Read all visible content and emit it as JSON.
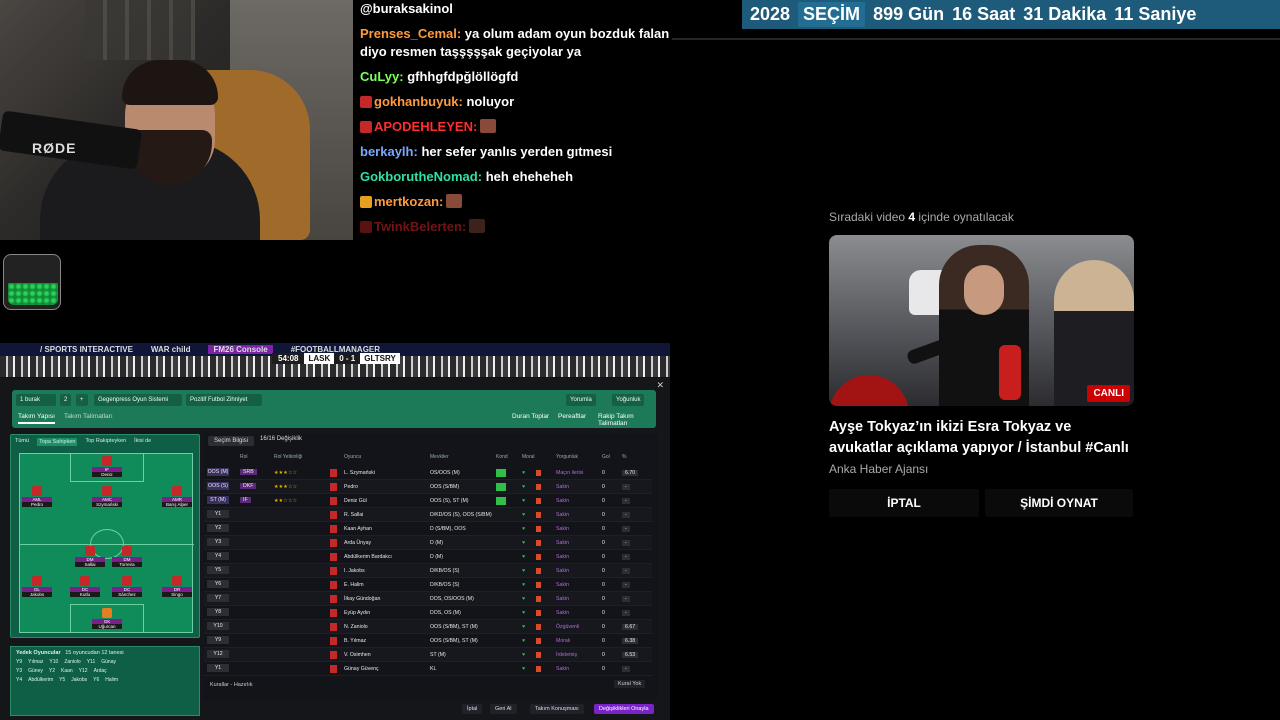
{
  "chat": {
    "messages": [
      {
        "user": "@buraksakinol",
        "text": "",
        "color": "#ffffff",
        "badge": ""
      },
      {
        "user": "Prenses_Cemal:",
        "text": "ya olum adam oyun bozduk falan diyo resmen taşşşşşak geçiyolar ya",
        "color": "#ff9b3d",
        "badge": ""
      },
      {
        "user": "CuLyy:",
        "text": "gfhhgfdpğlöllögfd",
        "color": "#7cff5a",
        "badge": ""
      },
      {
        "user": "gokhanbuyuk:",
        "text": "noluyor",
        "color": "#ff9b3d",
        "badge": "#c42828"
      },
      {
        "user": "APODEHLEYEN:",
        "text": "",
        "color": "#ff2d2d",
        "badge": "#c42828",
        "emote": true
      },
      {
        "user": "berkaylh:",
        "text": "her sefer yanlıs yerden gıtmesi",
        "color": "#7aa7ff",
        "badge": ""
      },
      {
        "user": "GokborutheNomad:",
        "text": "heh eheheheh",
        "color": "#2fe0a8",
        "badge": ""
      },
      {
        "user": "mertkozan:",
        "text": "",
        "color": "#ff9b3d",
        "badge": "#e6a020",
        "emote": true
      },
      {
        "user": "TwinkBelerten:",
        "text": "",
        "color": "#ff2d2d",
        "badge": "#c42828",
        "emote": true,
        "faded": true
      }
    ]
  },
  "webcam": {
    "mic_brand": "RØDE"
  },
  "countdown": {
    "year": "2028",
    "label": "SEÇİM",
    "days": "899",
    "days_unit": "Gün",
    "hours": "16",
    "hours_unit": "Saat",
    "minutes": "31",
    "minutes_unit": "Dakika",
    "seconds": "11",
    "seconds_unit": "Saniye"
  },
  "upnext": {
    "label_pre": "Sıradaki video",
    "seconds": "4",
    "label_post": "içinde oynatılacak",
    "live_badge": "CANLI",
    "title": "Ayşe Tokyaz’ın ikizi Esra Tokyaz ve avukatlar açıklama yapıyor / İstanbul #Canlı",
    "channel": "Anka Haber Ajansı",
    "cancel": "İPTAL",
    "play_now": "ŞİMDİ OYNAT"
  },
  "game": {
    "ads": [
      "/ SPORTS INTERACTIVE",
      "WAR child",
      "FM26 Console",
      "#FOOTBALLMANAGER"
    ],
    "score": {
      "time": "54:08",
      "home": "LASK",
      "score": "0 - 1",
      "away": "GLTSRY"
    },
    "top_chips": [
      "1 burak",
      "2",
      "+",
      "Gegenpress  Oyun Sistemi",
      "Pozitif Futbol  Zihniyet",
      "Yorumla",
      "Yoğunluk"
    ],
    "tabs": [
      "Takım Yapısı",
      "Takım Talimatları"
    ],
    "right_buttons": [
      "Duran Toplar",
      "Pereaftlar",
      "Rakip Takım Talimatları"
    ],
    "pitch_tabs": [
      "Tümü",
      "Topa Sahipken",
      "Top Rakipteyken",
      "İkisi de"
    ],
    "players": [
      {
        "role": "IF",
        "name": "Deniz",
        "num": "7"
      },
      {
        "role": "AML",
        "name": "Pedro",
        "num": "9"
      },
      {
        "role": "AMC",
        "name": "Szymański",
        "num": "10"
      },
      {
        "role": "AMR",
        "name": "Barış Alper",
        "num": "53"
      },
      {
        "role": "DM",
        "name": "Sallai",
        "num": "20"
      },
      {
        "role": "DM",
        "name": "Torreira",
        "num": "34"
      },
      {
        "role": "DL",
        "name": "Jakobs",
        "num": "4"
      },
      {
        "role": "DC",
        "name": "Kutlu",
        "num": "3"
      },
      {
        "role": "DC",
        "name": "Sánchez",
        "num": "6"
      },
      {
        "role": "DR",
        "name": "Singo",
        "num": "90"
      },
      {
        "role": "GK",
        "name": "Uğurcan",
        "num": "1"
      }
    ],
    "youth": {
      "title": "Yedek Oyuncular",
      "subtitle": "15 oyuncudan 12 tanesi",
      "rows": [
        [
          "Y9",
          "Yılmaz",
          "Y10",
          "Zaniolo",
          "Y11",
          "Günay"
        ],
        [
          "Y3",
          "Güney",
          "Y2",
          "Kaan",
          "Y12",
          "Ardaç"
        ],
        [
          "Y4",
          "Abdülkerim",
          "Y5",
          "Jakobs",
          "Y6",
          "Halim"
        ]
      ]
    },
    "table": {
      "title": "Seçim Bilgisi",
      "filter": "16/16 Değişiklik",
      "columns": [
        "Rol",
        "Rol Yetkinliği",
        "Oyuncu",
        "Mevkiler",
        "Kond",
        "Moral",
        "Yorgunluk",
        "Gol",
        "%"
      ],
      "rows": [
        {
          "pos": "OOS (M)",
          "role": "SRB",
          "stars": "★★★☆☆",
          "name": "L. Szymański",
          "posn": "OS/OOS (M)",
          "stat": "Maçın ilerisi",
          "gol": "0",
          "rat": "6.70",
          "starter": true
        },
        {
          "pos": "OOS (S)",
          "role": "DKF",
          "stars": "★★★☆☆",
          "name": "Pedro",
          "posn": "OOS (S/BM)",
          "stat": "Sakin",
          "gol": "0",
          "rat": "-",
          "starter": true
        },
        {
          "pos": "ST (M)",
          "role": "IF",
          "stars": "★★☆☆☆",
          "name": "Deniz Gül",
          "posn": "OOS (S), ST (M)",
          "stat": "Sakin",
          "gol": "0",
          "rat": "-",
          "starter": true
        },
        {
          "pos": "Y1",
          "role": "",
          "stars": "",
          "name": "R. Sallai",
          "posn": "D/KD/OS (S), OOS (S/BM)",
          "stat": "Sakin",
          "gol": "0",
          "rat": "-"
        },
        {
          "pos": "Y2",
          "role": "",
          "stars": "",
          "name": "Kaan Ayhan",
          "posn": "D (S/BM), OOS",
          "stat": "Sakin",
          "gol": "0",
          "rat": "-"
        },
        {
          "pos": "Y3",
          "role": "",
          "stars": "",
          "name": "Arda Ünyay",
          "posn": "D (M)",
          "stat": "Sakin",
          "gol": "0",
          "rat": "-"
        },
        {
          "pos": "Y4",
          "role": "",
          "stars": "",
          "name": "Abdülkerim Bardakcı",
          "posn": "D (M)",
          "stat": "Sakin",
          "gol": "0",
          "rat": "-"
        },
        {
          "pos": "Y5",
          "role": "",
          "stars": "",
          "name": "I. Jakobs",
          "posn": "D/KB/OS (S)",
          "stat": "Sakin",
          "gol": "0",
          "rat": "-"
        },
        {
          "pos": "Y6",
          "role": "",
          "stars": "",
          "name": "E. Halim",
          "posn": "D/KB/OS (S)",
          "stat": "Sakin",
          "gol": "0",
          "rat": "-"
        },
        {
          "pos": "Y7",
          "role": "",
          "stars": "",
          "name": "İlkay Gündoğan",
          "posn": "DOS, OS/OOS (M)",
          "stat": "Sakin",
          "gol": "0",
          "rat": "-"
        },
        {
          "pos": "Y8",
          "role": "",
          "stars": "",
          "name": "Eyüp Aydın",
          "posn": "DOS, OS (M)",
          "stat": "Sakin",
          "gol": "0",
          "rat": "-"
        },
        {
          "pos": "Y10",
          "role": "",
          "stars": "",
          "name": "N. Zaniolo",
          "posn": "OOS (S/BM), ST (M)",
          "stat": "Özgüvenli",
          "gol": "0",
          "rat": "6.67"
        },
        {
          "pos": "Y9",
          "role": "",
          "stars": "",
          "name": "B. Yılmaz",
          "posn": "OOS (S/BM), ST (M)",
          "stat": "Moralı",
          "gol": "0",
          "rat": "6.38"
        },
        {
          "pos": "Y12",
          "role": "",
          "stars": "",
          "name": "V. Osimhen",
          "posn": "ST (M)",
          "stat": "İrdelemiş",
          "gol": "0",
          "rat": "6.53"
        },
        {
          "pos": "Y1",
          "role": "",
          "stars": "",
          "name": "Günay Güvenç",
          "posn": "KL",
          "stat": "Sakin",
          "gol": "0",
          "rat": "-"
        }
      ],
      "footer_left": "Kurallar - Hazırlık",
      "footer_right": "Kural Yok"
    },
    "bottom_buttons": [
      "İptal",
      "Geri Al",
      "Takım Konuşması",
      "Değişiklikleri Onayla"
    ]
  }
}
